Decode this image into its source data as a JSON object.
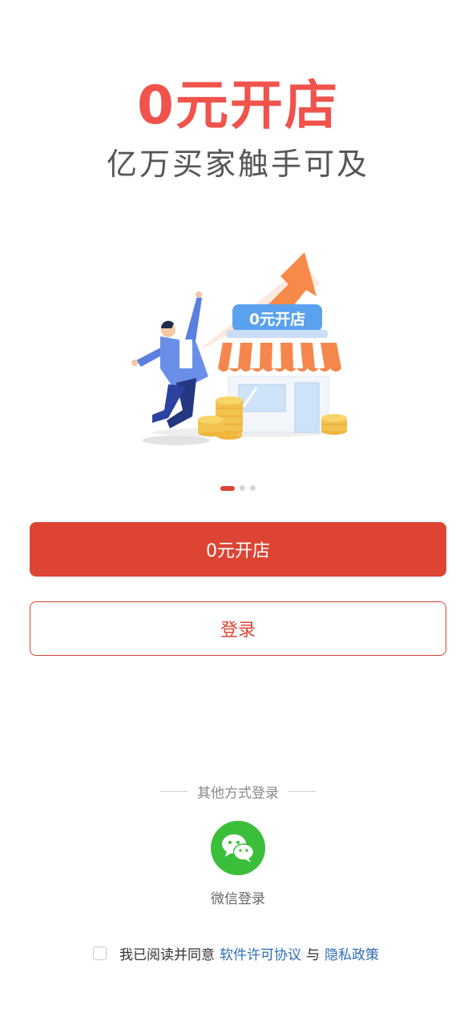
{
  "hero": {
    "title": "0元开店",
    "subtitle": "亿万买家触手可及"
  },
  "illustration": {
    "shop_sign": "0元开店",
    "icon": "shop-growth-illustration"
  },
  "carousel": {
    "page_count": 3,
    "active_index": 0
  },
  "actions": {
    "open_store_label": "0元开店",
    "login_label": "登录"
  },
  "other_login": {
    "title": "其他方式登录",
    "wechat_label": "微信登录",
    "wechat_icon": "wechat-icon"
  },
  "agreement": {
    "checked": false,
    "prefix": "我已阅读并同意",
    "license_link": "软件许可协议",
    "conjunction": "与",
    "privacy_link": "隐私政策"
  },
  "colors": {
    "brand_red": "#dd4433",
    "title_red": "#f0534c",
    "wechat_green": "#3bbf3b",
    "link_blue": "#2f6db5"
  }
}
